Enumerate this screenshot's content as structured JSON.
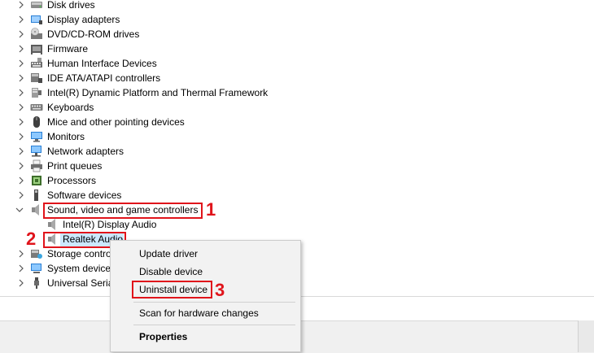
{
  "tree_items": [
    {
      "label": "Disk drives",
      "icon": "disk-drive-icon",
      "expanded": false
    },
    {
      "label": "Display adapters",
      "icon": "display-adapter-icon",
      "expanded": false
    },
    {
      "label": "DVD/CD-ROM drives",
      "icon": "dvd-drive-icon",
      "expanded": false
    },
    {
      "label": "Firmware",
      "icon": "firmware-icon",
      "expanded": false
    },
    {
      "label": "Human Interface Devices",
      "icon": "hid-icon",
      "expanded": false
    },
    {
      "label": "IDE ATA/ATAPI controllers",
      "icon": "ide-controller-icon",
      "expanded": false
    },
    {
      "label": "Intel(R) Dynamic Platform and Thermal Framework",
      "icon": "chip-icon",
      "expanded": false
    },
    {
      "label": "Keyboards",
      "icon": "keyboard-icon",
      "expanded": false
    },
    {
      "label": "Mice and other pointing devices",
      "icon": "mouse-icon",
      "expanded": false
    },
    {
      "label": "Monitors",
      "icon": "monitor-icon",
      "expanded": false
    },
    {
      "label": "Network adapters",
      "icon": "network-adapter-icon",
      "expanded": false
    },
    {
      "label": "Print queues",
      "icon": "printer-icon",
      "expanded": false
    },
    {
      "label": "Processors",
      "icon": "processor-icon",
      "expanded": false
    },
    {
      "label": "Software devices",
      "icon": "software-device-icon",
      "expanded": false
    },
    {
      "label": "Sound, video and game controllers",
      "icon": "speaker-icon",
      "expanded": true
    },
    {
      "label": "Intel(R) Display Audio",
      "icon": "speaker-icon",
      "child": true
    },
    {
      "label": "Realtek Audio",
      "icon": "speaker-icon",
      "child": true,
      "selected": true
    },
    {
      "label": "Storage contro",
      "icon": "storage-icon",
      "expanded": false
    },
    {
      "label": "System devices",
      "icon": "system-device-icon",
      "expanded": false
    },
    {
      "label": "Universal Seria",
      "icon": "usb-icon",
      "expanded": false
    }
  ],
  "context_menu": {
    "update_driver": "Update driver",
    "disable_device": "Disable device",
    "uninstall_device": "Uninstall device",
    "scan_hardware": "Scan for hardware changes",
    "properties": "Properties"
  },
  "annotations": {
    "step1": "1",
    "step2": "2",
    "step3": "3"
  },
  "colors": {
    "annotation": "#e0141b",
    "selection": "#cce8ff"
  }
}
